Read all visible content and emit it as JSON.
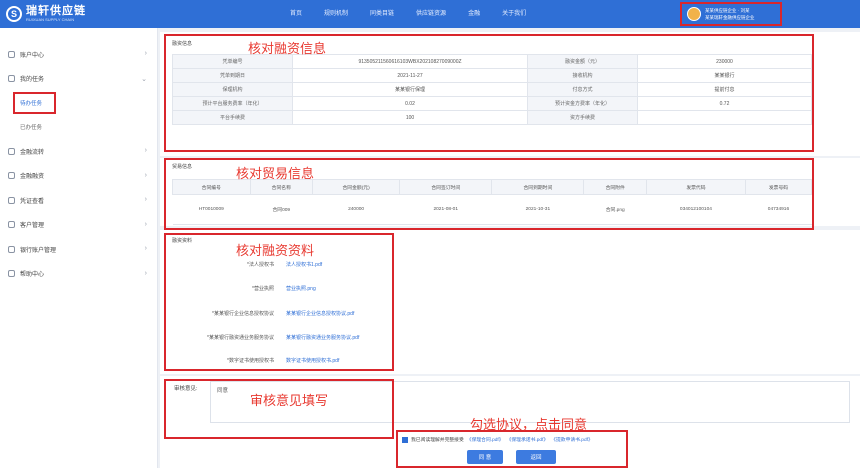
{
  "header": {
    "logo_mark": "S",
    "logo_name": "瑞轩供应链",
    "logo_sub": "RUIXUAN SUPPLY CHAIN",
    "nav": [
      "首页",
      "规则机制",
      "同类目链",
      "供应链资源",
      "金融",
      "关于我们"
    ],
    "user_line1": "某某供应链企业 · 刘某",
    "user_line2": "某某瑞轩金融供应链企业"
  },
  "sidebar": {
    "items": [
      {
        "label": "账户中心",
        "expanded": false
      },
      {
        "label": "我的任务",
        "expanded": true
      },
      {
        "label": "金融流转",
        "expanded": false
      },
      {
        "label": "金融融资",
        "expanded": false
      },
      {
        "label": "凭证查看",
        "expanded": false
      },
      {
        "label": "客户管理",
        "expanded": false
      },
      {
        "label": "银行账户管理",
        "expanded": false
      },
      {
        "label": "帮助中心",
        "expanded": false
      }
    ],
    "subitems": [
      "待办任务",
      "已办任务"
    ]
  },
  "annotations": {
    "financing": "核对融资信息",
    "trade": "核对贸易信息",
    "docs": "核对融资资料",
    "review": "审核意见填写",
    "agree": "勾选协议，点击同意"
  },
  "financing": {
    "title": "融资信息",
    "rows": [
      [
        "凭单编号",
        "913505211560616103WBX20210827009000Z",
        "融资金额（元）",
        "230000"
      ],
      [
        "凭单到期日",
        "2021-11-27",
        "接收机构",
        "某某银行"
      ],
      [
        "保理机构",
        "某某银行保理",
        "付息方式",
        "提前付息"
      ],
      [
        "预计平台服务费率（年化）",
        "0.02",
        "预计资金方费率（年化）",
        "0.72"
      ],
      [
        "平台手续费",
        "100",
        "资方手续费",
        ""
      ]
    ]
  },
  "trade": {
    "title": "贸易信息",
    "headers": [
      "合同编号",
      "合同名称",
      "合同金额(元)",
      "合同签订时间",
      "合同到期时间",
      "合同附件",
      "发票代码",
      "发票号码"
    ],
    "rows": [
      [
        "HT0010009",
        "合同009",
        "240000",
        "2021-08-01",
        "2021-10-31",
        "合同.png",
        "034012100104",
        "04734916"
      ]
    ]
  },
  "docs": {
    "title": "融资资料",
    "items": [
      {
        "label": "*法人授权书",
        "file": "法人授权书1.pdf"
      },
      {
        "label": "*营业执照",
        "file": "营业执照.png"
      },
      {
        "label": "*某某银行企业信息授权协议",
        "file": "某某银行企业信息授权协议.pdf"
      },
      {
        "label": "*某某银行融资通业务服务协议",
        "file": "某某银行融资通业务服务协议.pdf"
      },
      {
        "label": "*数字证书使用授权书",
        "file": "数字证书使用授权书.pdf"
      }
    ]
  },
  "review": {
    "label": "审核意见:",
    "value": "同意"
  },
  "agreement": {
    "text": "我已阅读理解并完整接受",
    "links": [
      "《保理合同.pdf》",
      "《保理承诺书.pdf》",
      "《提款申请书.pdf》"
    ]
  },
  "buttons": {
    "agree": "同 意",
    "back": "返回"
  }
}
